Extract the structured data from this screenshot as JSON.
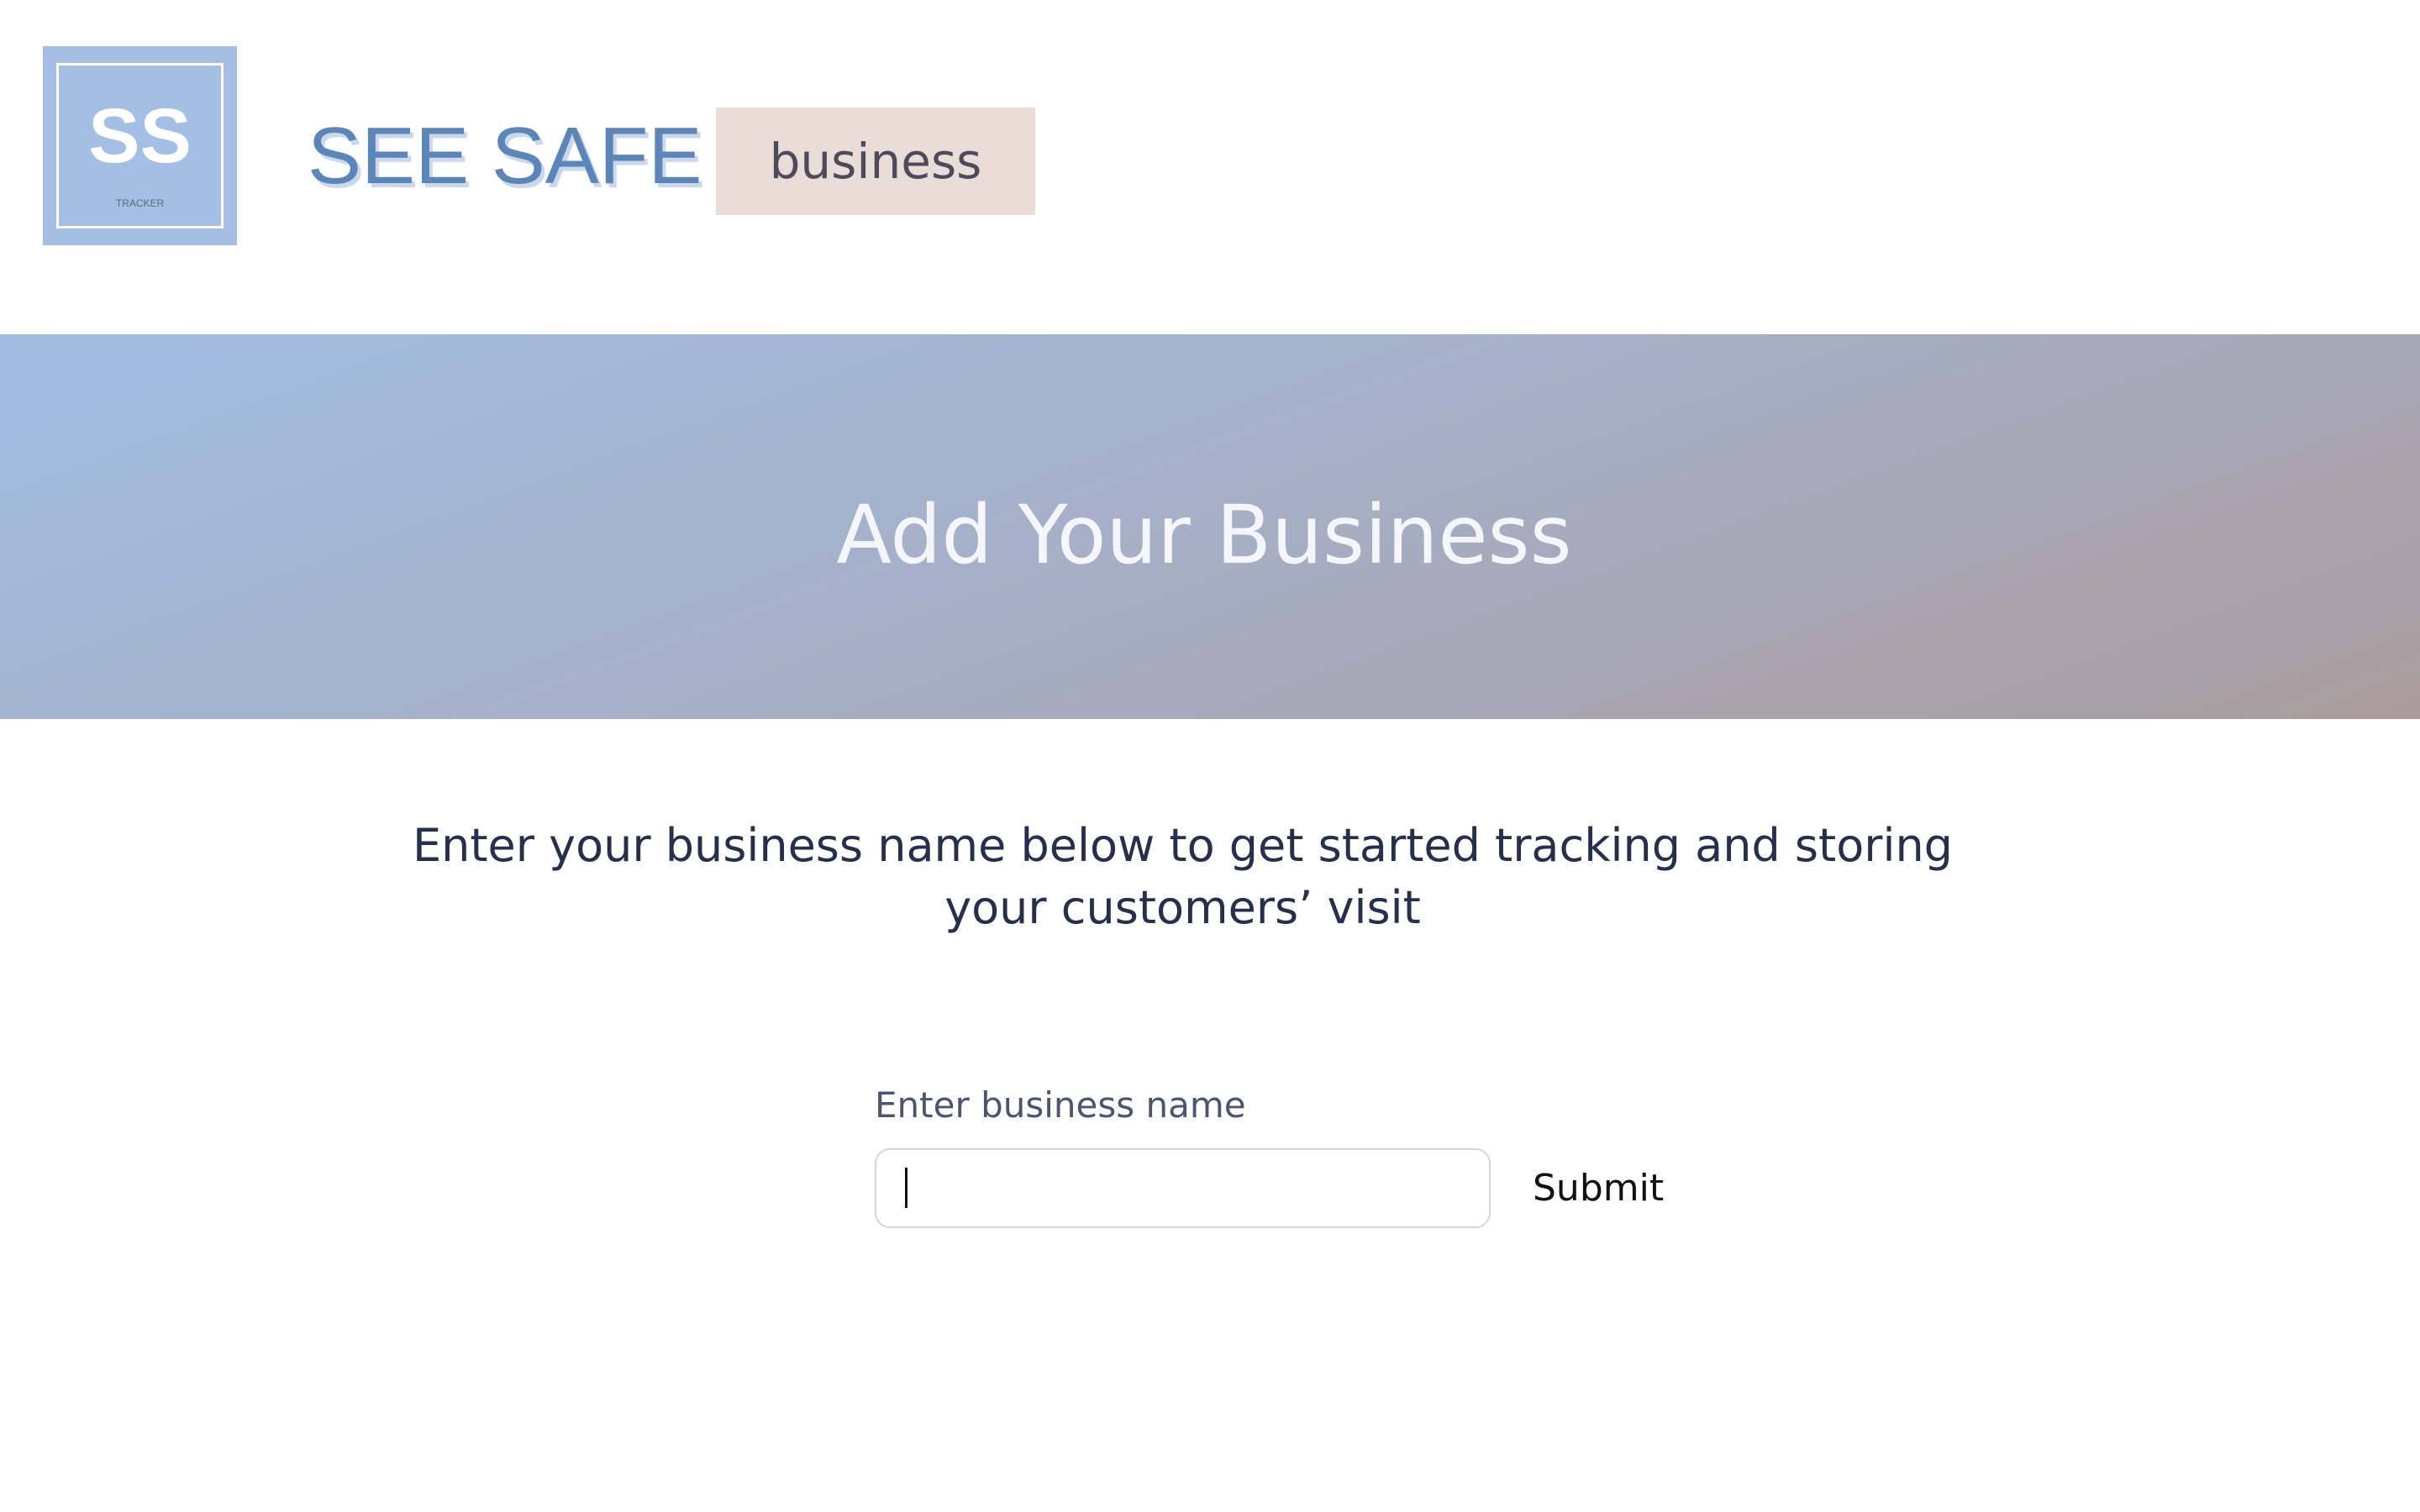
{
  "header": {
    "logo": {
      "initials": "SS",
      "subtitle": "TRACKER"
    },
    "brand_title": "SEE SAFE",
    "badge": "business"
  },
  "hero": {
    "title": "Add Your Business"
  },
  "intro": {
    "text": "Enter your business name below to get started tracking and storing your customers’ visit"
  },
  "form": {
    "label": "Enter business name",
    "input_value": "",
    "submit_label": "Submit"
  },
  "colors": {
    "logo_bg": "#a4bfe3",
    "brand_title": "#5c86b9",
    "badge_bg": "#e9ddd8",
    "hero_gradient_start": "#a2bde3",
    "hero_gradient_end": "#a99c9d",
    "intro_text": "#262f4b"
  }
}
